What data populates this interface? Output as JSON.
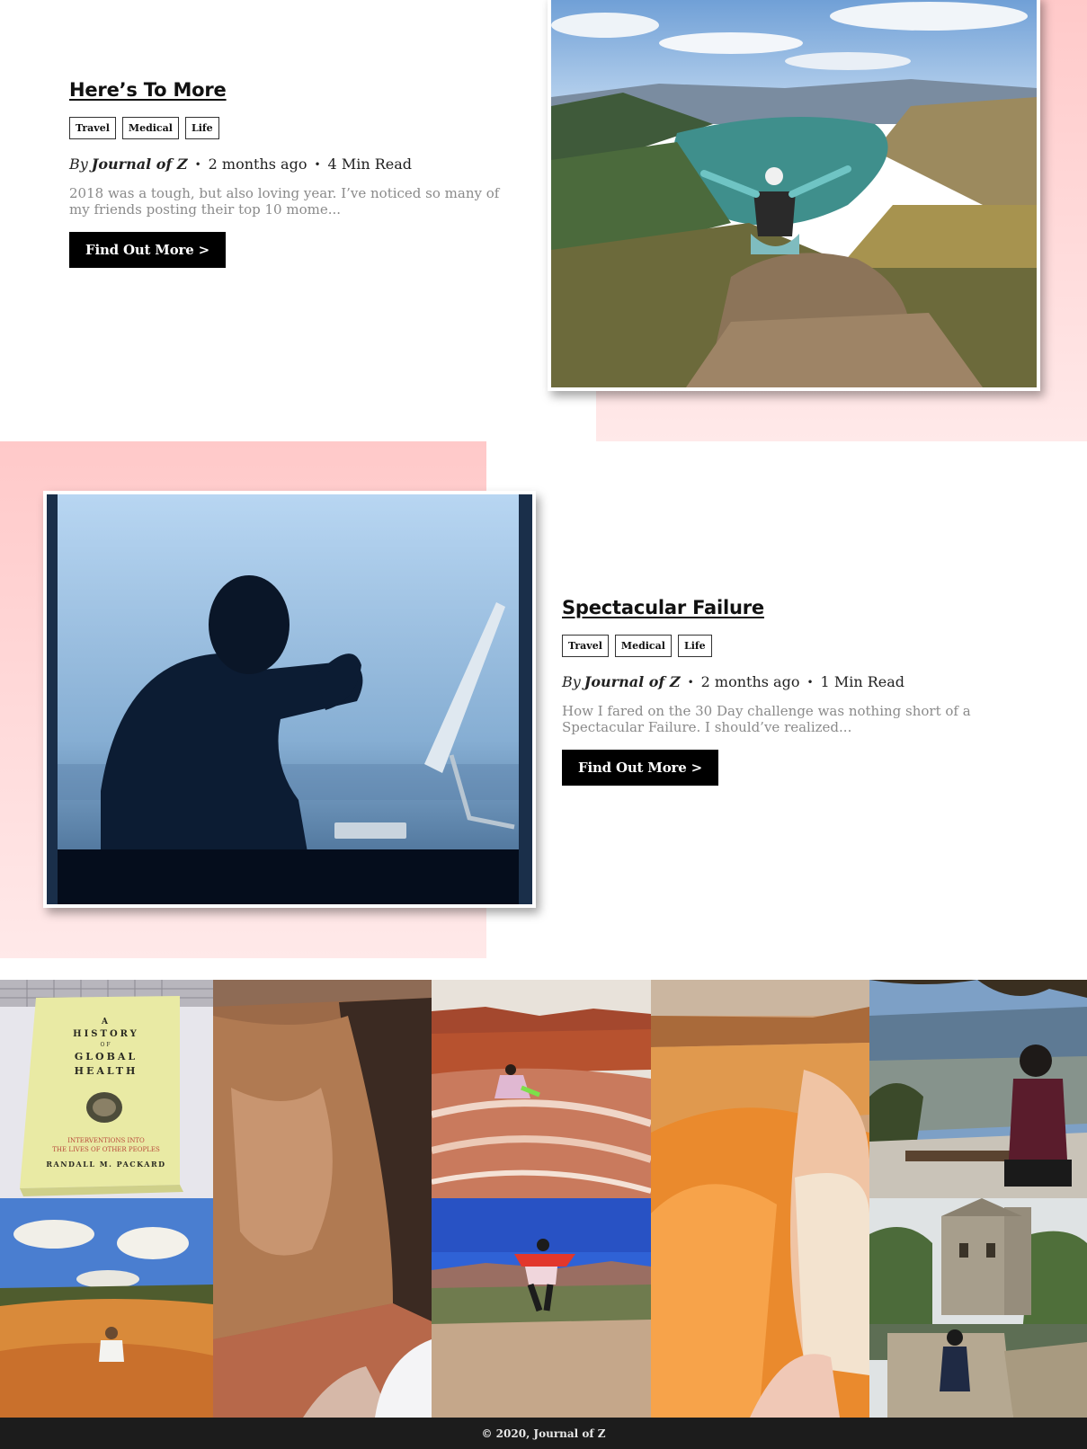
{
  "posts": [
    {
      "title": "Here’s To More",
      "tags": [
        "Travel",
        "Medical",
        "Life"
      ],
      "by": "By",
      "author": "Journal of Z",
      "age": "2 months ago",
      "read_time": "4 Min Read",
      "excerpt": "2018 was a tough, but also loving year. I’ve noticed so many of my friends posting their top 10 mome...",
      "cta": "Find Out More >"
    },
    {
      "title": "Spectacular Failure",
      "tags": [
        "Travel",
        "Medical",
        "Life"
      ],
      "by": "By",
      "author": "Journal of Z",
      "age": "2 months ago",
      "read_time": "1 Min Read",
      "excerpt": "How I fared on the 30 Day challenge was nothing short of a Spectacular Failure. I should’ve realized...",
      "cta": "Find Out More >"
    }
  ],
  "gallery": {
    "book_cover": {
      "title_lines": [
        "A",
        "HISTORY",
        "OF",
        "GLOBAL",
        "HEALTH"
      ],
      "subtitle_lines": [
        "INTERVENTIONS INTO",
        "THE LIVES OF OTHER PEOPLES"
      ],
      "author": "RANDALL M. PACKARD"
    }
  },
  "footer": {
    "copyright": "© 2020, Journal of Z"
  },
  "colors": {
    "pink_top": "#ffc9c9",
    "pink_bottom": "#ffe9e9",
    "button_bg": "#000000",
    "footer_bg": "#1c1c1c"
  }
}
